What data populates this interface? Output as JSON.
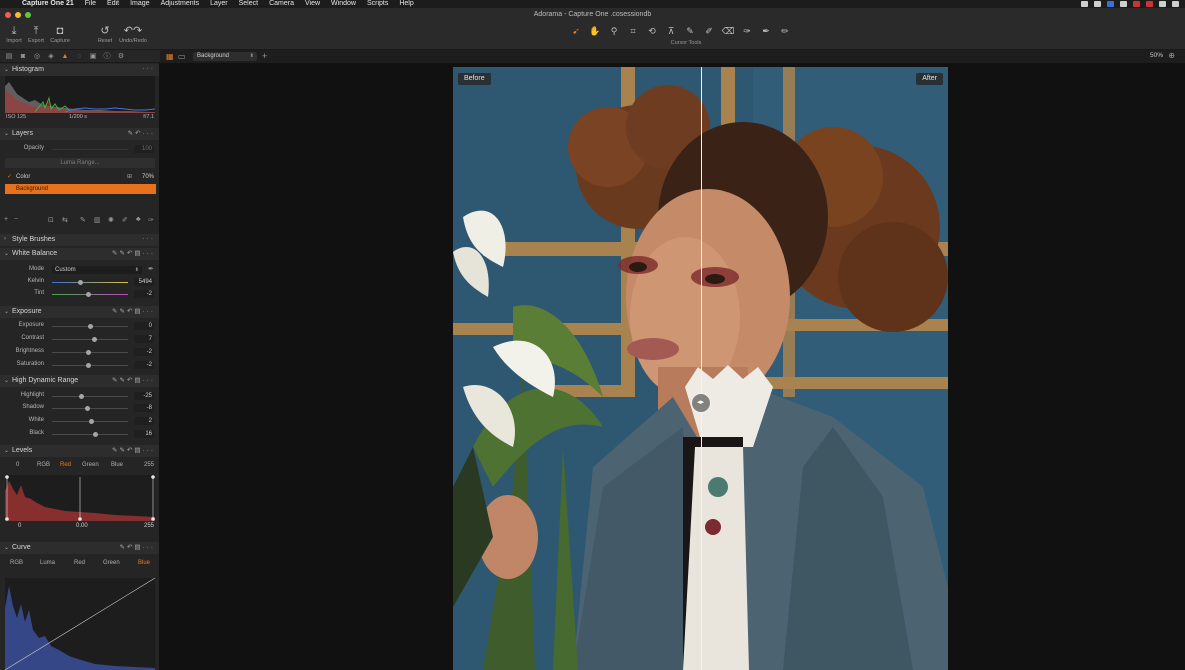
{
  "menubar": {
    "app": "Capture One 21",
    "items": [
      "File",
      "Edit",
      "Image",
      "Adjustments",
      "Layer",
      "Select",
      "Camera",
      "View",
      "Window",
      "Scripts",
      "Help"
    ]
  },
  "window": {
    "title": "Adorama - Capture One .cosessiondb"
  },
  "toolbar": {
    "import": "Import",
    "export": "Export",
    "capture": "Capture",
    "reset": "Reset",
    "undo_redo": "Undo/Redo",
    "cursor_tools": "Cursor Tools"
  },
  "viewer_bar": {
    "variant": "Background",
    "zoom": "50%"
  },
  "histogram": {
    "title": "Histogram",
    "iso": "ISO 125",
    "shutter": "1/200 s",
    "aperture": "f/7.1"
  },
  "layers": {
    "title": "Layers",
    "opacity_label": "Opacity",
    "opacity_value": "100",
    "luma_range": "Luma Range...",
    "items": [
      {
        "name": "Color",
        "opacity": "70%",
        "checked": true
      },
      {
        "name": "Background",
        "selected": true
      }
    ]
  },
  "style_brushes": {
    "title": "Style Brushes"
  },
  "white_balance": {
    "title": "White Balance",
    "mode_label": "Mode",
    "mode_value": "Custom",
    "kelvin_label": "Kelvin",
    "kelvin_value": "5494",
    "kelvin_pos": 0.37,
    "tint_label": "Tint",
    "tint_value": "-2",
    "tint_pos": 0.47
  },
  "exposure": {
    "title": "Exposure",
    "rows": [
      {
        "label": "Exposure",
        "value": "0",
        "pos": 0.5
      },
      {
        "label": "Contrast",
        "value": "7",
        "pos": 0.55
      },
      {
        "label": "Brightness",
        "value": "-2",
        "pos": 0.48
      },
      {
        "label": "Saturation",
        "value": "-2",
        "pos": 0.48
      }
    ]
  },
  "hdr": {
    "title": "High Dynamic Range",
    "rows": [
      {
        "label": "Highlight",
        "value": "-25",
        "pos": 0.38
      },
      {
        "label": "Shadow",
        "value": "-8",
        "pos": 0.46
      },
      {
        "label": "White",
        "value": "2",
        "pos": 0.51
      },
      {
        "label": "Black",
        "value": "16",
        "pos": 0.57
      }
    ]
  },
  "levels": {
    "title": "Levels",
    "left_value": "0",
    "right_value": "255",
    "tabs": [
      "RGB",
      "Red",
      "Green",
      "Blue"
    ],
    "active_tab": "Red",
    "input_low": "0",
    "midpoint": "0.00",
    "input_high": "255"
  },
  "curve": {
    "title": "Curve",
    "tabs": [
      "RGB",
      "Luma",
      "Red",
      "Green",
      "Blue"
    ],
    "active_tab": "Blue"
  },
  "viewer": {
    "before": "Before",
    "after": "After",
    "split_pos": 0.5
  },
  "colors": {
    "accent": "#e8721b",
    "panel": "#252525",
    "backdrop": "#2f5670"
  }
}
